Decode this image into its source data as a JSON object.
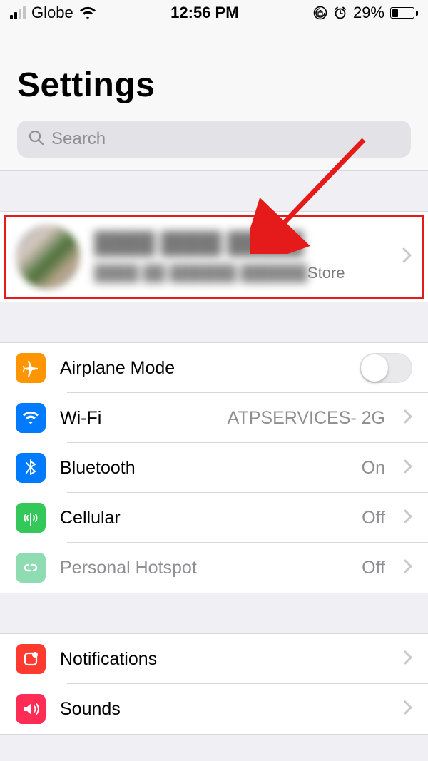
{
  "status": {
    "carrier": "Globe",
    "time": "12:56 PM",
    "battery_pct": "29%",
    "battery_fill": 29
  },
  "header": {
    "title": "Settings",
    "search_placeholder": "Search"
  },
  "appleid": {
    "name_masked": "████ ████ █████",
    "sub_masked": "████ ██ ██████ ██████",
    "sub_suffix": " Store"
  },
  "rows": {
    "airplane": {
      "label": "Airplane Mode"
    },
    "wifi": {
      "label": "Wi-Fi",
      "value": "ATPSERVICES- 2G"
    },
    "bt": {
      "label": "Bluetooth",
      "value": "On"
    },
    "cell": {
      "label": "Cellular",
      "value": "Off"
    },
    "hotspot": {
      "label": "Personal Hotspot",
      "value": "Off"
    },
    "notif": {
      "label": "Notifications"
    },
    "sound": {
      "label": "Sounds"
    }
  }
}
